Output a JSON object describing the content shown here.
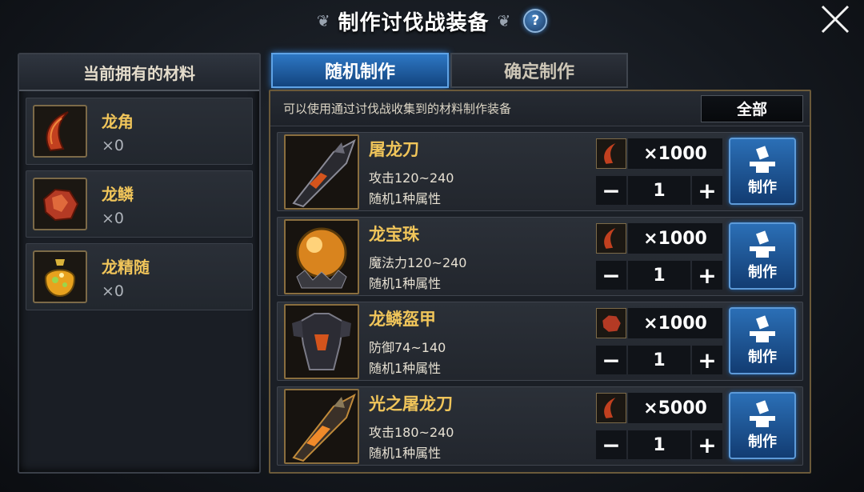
{
  "title": "制作讨伐战装备",
  "help_label": "?",
  "left_panel": {
    "header": "当前拥有的材料",
    "materials": [
      {
        "name": "龙角",
        "count": "×0",
        "icon": "dragon-horn-icon"
      },
      {
        "name": "龙鳞",
        "count": "×0",
        "icon": "dragon-scale-icon"
      },
      {
        "name": "龙精随",
        "count": "×0",
        "icon": "dragon-essence-icon"
      }
    ]
  },
  "tabs": [
    {
      "label": "随机制作",
      "active": true
    },
    {
      "label": "确定制作",
      "active": false
    }
  ],
  "info_bar": {
    "text": "可以使用通过讨伐战收集到的材料制作装备",
    "filter_label": "全部"
  },
  "recipes": [
    {
      "name": "屠龙刀",
      "stat": "攻击120~240",
      "attr": "随机1种属性",
      "material_icon": "dragon-horn-icon",
      "cost": "×1000",
      "quantity": "1",
      "craft_label": "制作",
      "icon": "blade-icon"
    },
    {
      "name": "龙宝珠",
      "stat": "魔法力120~240",
      "attr": "随机1种属性",
      "material_icon": "dragon-horn-icon",
      "cost": "×1000",
      "quantity": "1",
      "craft_label": "制作",
      "icon": "orb-icon"
    },
    {
      "name": "龙鳞盔甲",
      "stat": "防御74~140",
      "attr": "随机1种属性",
      "material_icon": "dragon-scale-icon",
      "cost": "×1000",
      "quantity": "1",
      "craft_label": "制作",
      "icon": "armor-icon"
    },
    {
      "name": "光之屠龙刀",
      "stat": "攻击180~240",
      "attr": "随机1种属性",
      "material_icon": "dragon-horn-icon",
      "cost": "×5000",
      "quantity": "1",
      "craft_label": "制作",
      "icon": "light-blade-icon"
    }
  ],
  "qty_controls": {
    "minus": "−",
    "plus": "+"
  },
  "colors": {
    "accent_gold": "#f0c55a",
    "accent_blue": "#2d77c4"
  }
}
